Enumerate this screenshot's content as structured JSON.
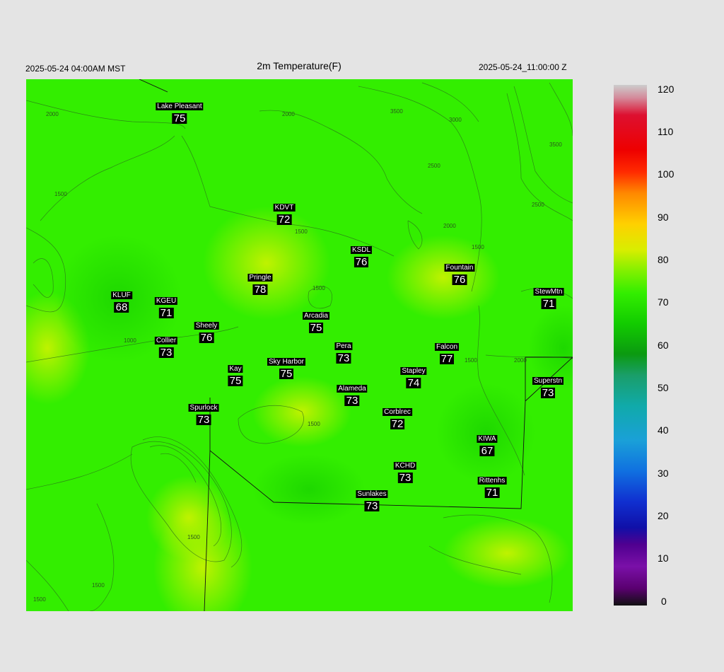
{
  "header": {
    "local_time": "2025-05-24 04:00AM MST",
    "title": "2m Temperature(F)",
    "utc_time": "2025-05-24_11:00:00 Z"
  },
  "colorbar": {
    "ticks": [
      "120",
      "110",
      "100",
      "90",
      "80",
      "70",
      "60",
      "50",
      "40",
      "30",
      "20",
      "10",
      "0"
    ],
    "range": [
      0,
      120
    ]
  },
  "map": {
    "background_color": "#33ee00",
    "contour_labels": [
      "2000",
      "3500",
      "3000",
      "2000",
      "1500",
      "2500",
      "2000",
      "1500",
      "1500",
      "3500",
      "2500",
      "1500",
      "1000",
      "1500",
      "2000",
      "1500",
      "1500",
      "1500",
      "1500"
    ],
    "stations": [
      {
        "name": "Lake Pleasant",
        "value": "75"
      },
      {
        "name": "KDVT",
        "value": "72"
      },
      {
        "name": "KSDL",
        "value": "76"
      },
      {
        "name": "Fountain",
        "value": "76"
      },
      {
        "name": "Pringle",
        "value": "78"
      },
      {
        "name": "StewMtn",
        "value": "71"
      },
      {
        "name": "KLUF",
        "value": "68"
      },
      {
        "name": "KGEU",
        "value": "71"
      },
      {
        "name": "Arcadia",
        "value": "75"
      },
      {
        "name": "Sheely",
        "value": "76"
      },
      {
        "name": "Collier",
        "value": "73"
      },
      {
        "name": "Pera",
        "value": "73"
      },
      {
        "name": "Falcon",
        "value": "77"
      },
      {
        "name": "Kay",
        "value": "75"
      },
      {
        "name": "Sky Harbor",
        "value": "75"
      },
      {
        "name": "Stapley",
        "value": "74"
      },
      {
        "name": "Superstn",
        "value": "73"
      },
      {
        "name": "Alameda",
        "value": "73"
      },
      {
        "name": "Spurlock",
        "value": "73"
      },
      {
        "name": "Corblrec",
        "value": "72"
      },
      {
        "name": "KIWA",
        "value": "67"
      },
      {
        "name": "KCHD",
        "value": "73"
      },
      {
        "name": "Rittenhs",
        "value": "71"
      },
      {
        "name": "Sunlakes",
        "value": "73"
      }
    ]
  }
}
